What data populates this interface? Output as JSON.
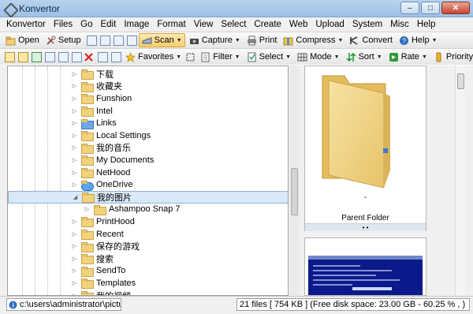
{
  "window": {
    "title": "Konvertor",
    "minimize": "–",
    "maximize": "□",
    "close": "✕"
  },
  "menu": [
    "Konvertor",
    "Files",
    "Go",
    "Edit",
    "Image",
    "Format",
    "View",
    "Select",
    "Create",
    "Web",
    "Upload",
    "System",
    "Misc",
    "Help"
  ],
  "toolbar1": {
    "open": "Open",
    "setup": "Setup",
    "scan": "Scan",
    "capture": "Capture",
    "print": "Print",
    "compress": "Compress",
    "convert": "Convert",
    "help": "Help"
  },
  "toolbar2": {
    "favorites": "Favorites",
    "filter": "Filter",
    "select": "Select",
    "mode": "Mode",
    "sort": "Sort",
    "rate": "Rate",
    "priority": "Priority"
  },
  "tree": [
    {
      "label": "下载",
      "icon": "folder"
    },
    {
      "label": "收藏夹",
      "icon": "folder"
    },
    {
      "label": "Funshion",
      "icon": "folder"
    },
    {
      "label": "Intel",
      "icon": "folder"
    },
    {
      "label": "Links",
      "icon": "folder-blue"
    },
    {
      "label": "Local Settings",
      "icon": "folder-link"
    },
    {
      "label": "我的音乐",
      "icon": "folder"
    },
    {
      "label": "My Documents",
      "icon": "folder-link"
    },
    {
      "label": "NetHood",
      "icon": "folder-link"
    },
    {
      "label": "OneDrive",
      "icon": "cloud"
    },
    {
      "label": "我的图片",
      "icon": "folder",
      "selected": true
    },
    {
      "label": "Ashampoo Snap 7",
      "icon": "folder",
      "child": true
    },
    {
      "label": "PrintHood",
      "icon": "folder-link"
    },
    {
      "label": "Recent",
      "icon": "folder-link"
    },
    {
      "label": "保存的游戏",
      "icon": "folder"
    },
    {
      "label": "搜索",
      "icon": "folder"
    },
    {
      "label": "SendTo",
      "icon": "folder-link"
    },
    {
      "label": "Templates",
      "icon": "folder-link"
    },
    {
      "label": "我的视频",
      "icon": "folder"
    }
  ],
  "preview": {
    "parent_caption": "Parent Folder",
    "parent_mark": "-",
    "bar_text": "• •"
  },
  "status": {
    "path": "c:\\users\\administrator\\pictur",
    "info": "21 files [ 754 KB ]  (Free disk space: 23.00 GB  -  60.25 % , )"
  },
  "colors": {
    "selection": "#d9e8f7",
    "folder": "#f2d27b",
    "titlebar": "#b7d2ee"
  }
}
